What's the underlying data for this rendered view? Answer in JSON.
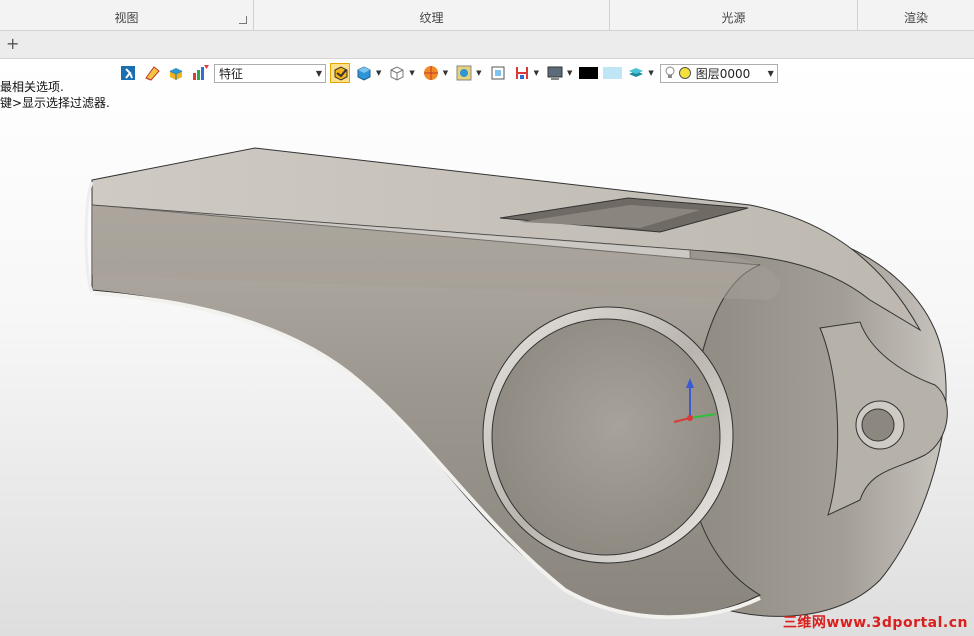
{
  "ribbon": {
    "groups": [
      {
        "label": "视图"
      },
      {
        "label": "纹理"
      },
      {
        "label": "光源"
      },
      {
        "label": "渲染"
      }
    ]
  },
  "tabs": {
    "add_label": "+"
  },
  "toolbar": {
    "filter_value": "特征",
    "layer_value": "图层0000",
    "color_swatches": [
      "#000000",
      "#bfe6f5"
    ]
  },
  "prompt": {
    "line1": "最相关选项.",
    "line2": "键>显示选择过滤器."
  },
  "watermark": "三维网www.3dportal.cn",
  "colors": {
    "active_highlight": "#ffe08a",
    "model_body": "#9a958e",
    "watermark": "#d9201e"
  }
}
